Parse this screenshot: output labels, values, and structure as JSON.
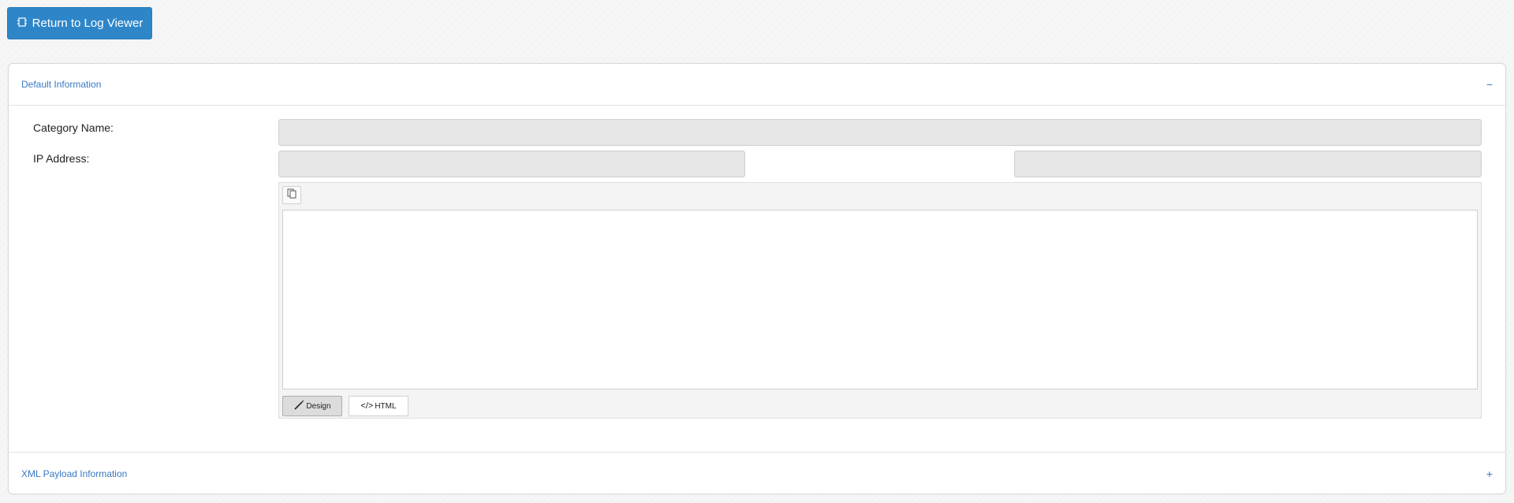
{
  "toolbar": {
    "return_label": "Return to Log Viewer",
    "return_icon": "log-icon"
  },
  "sections": {
    "default": {
      "title": "Default Information",
      "toggle": "−"
    },
    "xml": {
      "title": "XML Payload Information",
      "toggle": "+"
    }
  },
  "form": {
    "category_label": "Category Name:",
    "category_value": "",
    "ip_label": "IP Address:",
    "ip_value_1": "",
    "ip_value_2": ""
  },
  "editor": {
    "copy_icon": "copy-icon",
    "design_label": "Design",
    "html_label": "HTML",
    "content": ""
  }
}
